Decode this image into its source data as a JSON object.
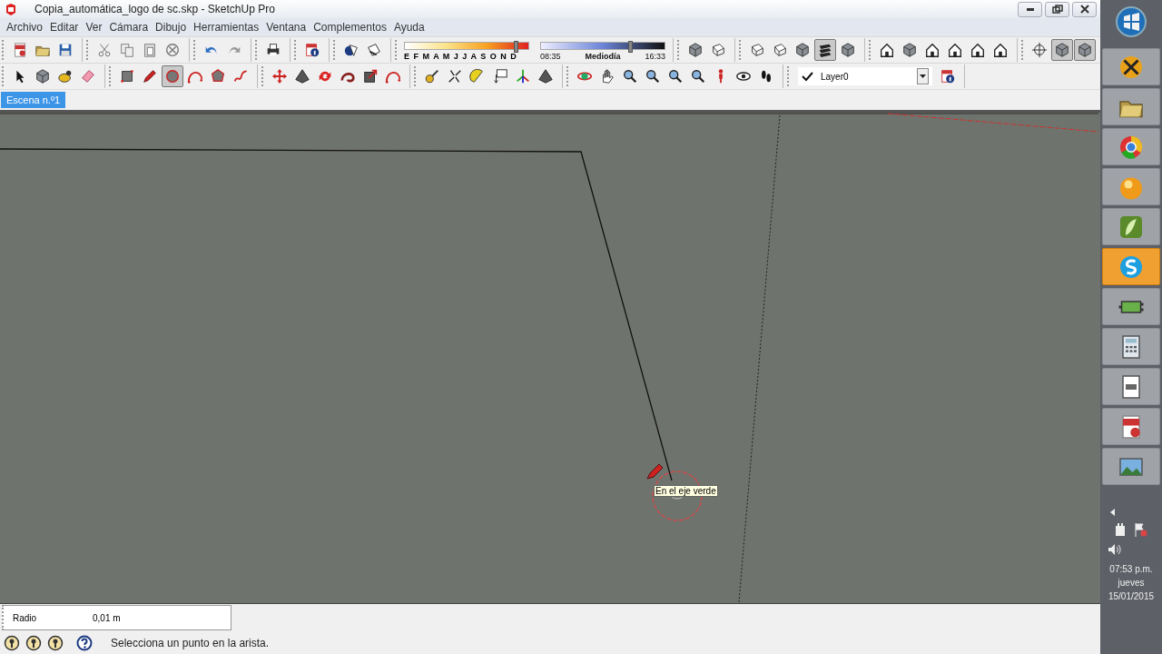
{
  "window": {
    "title": "Copia_automática_logo de sc.skp - SketchUp Pro"
  },
  "menu": [
    "Archivo",
    "Editar",
    "Ver",
    "Cámara",
    "Dibujo",
    "Herramientas",
    "Ventana",
    "Complementos",
    "Ayuda"
  ],
  "toolbar_rows": [
    [
      [
        {
          "kind": "document",
          "selected": false
        },
        {
          "kind": "folder",
          "selected": false
        },
        {
          "kind": "disk",
          "selected": false
        }
      ],
      [
        {
          "kind": "scissors",
          "selected": false
        },
        {
          "kind": "copy",
          "selected": false
        },
        {
          "kind": "paste",
          "selected": false
        },
        {
          "kind": "cancel",
          "selected": false
        }
      ],
      [
        {
          "kind": "undo",
          "selected": false
        },
        {
          "kind": "redo",
          "selected": false
        }
      ],
      [
        {
          "kind": "printer",
          "selected": false
        }
      ],
      [
        {
          "kind": "info",
          "selected": false
        }
      ],
      [
        {
          "kind": "shadow",
          "selected": false
        },
        {
          "kind": "fog",
          "selected": false
        }
      ],
      [
        {
          "kind": "slider"
        }
      ],
      [
        {
          "kind": "cube",
          "selected": false
        },
        {
          "kind": "box",
          "selected": false
        }
      ],
      [
        {
          "kind": "box",
          "selected": false
        },
        {
          "kind": "box",
          "selected": false
        },
        {
          "kind": "cube",
          "selected": false
        },
        {
          "kind": "stripes",
          "selected": true
        },
        {
          "kind": "cube",
          "selected": false
        }
      ],
      [
        {
          "kind": "house",
          "selected": false
        },
        {
          "kind": "cube",
          "selected": false
        },
        {
          "kind": "house",
          "selected": false
        },
        {
          "kind": "house",
          "selected": false
        },
        {
          "kind": "house",
          "selected": false
        },
        {
          "kind": "house",
          "selected": false
        }
      ],
      [
        {
          "kind": "crosshair",
          "selected": false
        },
        {
          "kind": "cube",
          "selected": true
        },
        {
          "kind": "cube",
          "selected": true
        }
      ]
    ],
    [
      [
        {
          "kind": "arrow",
          "selected": false
        },
        {
          "kind": "cube",
          "selected": false
        },
        {
          "kind": "paint",
          "selected": false
        },
        {
          "kind": "eraser",
          "selected": false
        }
      ],
      [
        {
          "kind": "square",
          "selected": false
        },
        {
          "kind": "pencil",
          "selected": false
        },
        {
          "kind": "circle",
          "selected": true
        },
        {
          "kind": "arc",
          "selected": false
        },
        {
          "kind": "polygon",
          "selected": false
        },
        {
          "kind": "squiggle",
          "selected": false
        }
      ],
      [
        {
          "kind": "move",
          "selected": false
        },
        {
          "kind": "pyramid",
          "selected": false
        },
        {
          "kind": "rotate",
          "selected": false
        },
        {
          "kind": "spiral",
          "selected": false
        },
        {
          "kind": "scale",
          "selected": false
        },
        {
          "kind": "arc",
          "selected": false
        }
      ],
      [
        {
          "kind": "tape",
          "selected": false
        },
        {
          "kind": "dimension",
          "selected": false
        },
        {
          "kind": "protractor",
          "selected": false
        },
        {
          "kind": "text",
          "selected": false
        },
        {
          "kind": "axes",
          "selected": false
        },
        {
          "kind": "pyramid",
          "selected": false
        }
      ],
      [
        {
          "kind": "orbit",
          "selected": false
        },
        {
          "kind": "hand",
          "selected": false
        },
        {
          "kind": "magnifier",
          "selected": false
        },
        {
          "kind": "magnifier",
          "selected": false
        },
        {
          "kind": "magnifier",
          "selected": false
        },
        {
          "kind": "magnifier",
          "selected": false
        },
        {
          "kind": "figure",
          "selected": false
        },
        {
          "kind": "eye",
          "selected": false
        },
        {
          "kind": "footprints",
          "selected": false
        }
      ],
      [
        {
          "kind": "layer"
        }
      ]
    ]
  ],
  "shadow_settings": {
    "months": "E F M A M J J A S O N D",
    "month_slider": {
      "level": 0.9
    },
    "time_slider": {
      "level": 0.72
    },
    "time_start": "08:35",
    "time_mid": "Mediodía",
    "time_end": "16:33"
  },
  "layer": {
    "name": "Layer0",
    "checked": true
  },
  "scene_tabs": [
    {
      "label": "Escena n.º1",
      "selected": true
    }
  ],
  "viewport": {
    "tooltip": "En el eje verde"
  },
  "measurements": {
    "label": "Radio",
    "value": "0,01 m"
  },
  "status_bar": {
    "message": "Selecciona un punto en la arista."
  },
  "taskbar": {
    "apps": [
      {
        "kind": "tools",
        "selected": false
      },
      {
        "kind": "folder",
        "selected": false
      },
      {
        "kind": "browser",
        "selected": false
      },
      {
        "kind": "ball",
        "selected": false
      },
      {
        "kind": "leaf",
        "selected": false
      },
      {
        "kind": "chat",
        "selected": true
      },
      {
        "kind": "plug",
        "selected": false
      },
      {
        "kind": "calculator",
        "selected": false
      },
      {
        "kind": "note",
        "selected": false
      },
      {
        "kind": "document",
        "selected": false
      },
      {
        "kind": "photo",
        "selected": false
      }
    ],
    "clock_time": "07:53 p.m.",
    "clock_day": "jueves",
    "clock_date": "15/01/2015"
  }
}
